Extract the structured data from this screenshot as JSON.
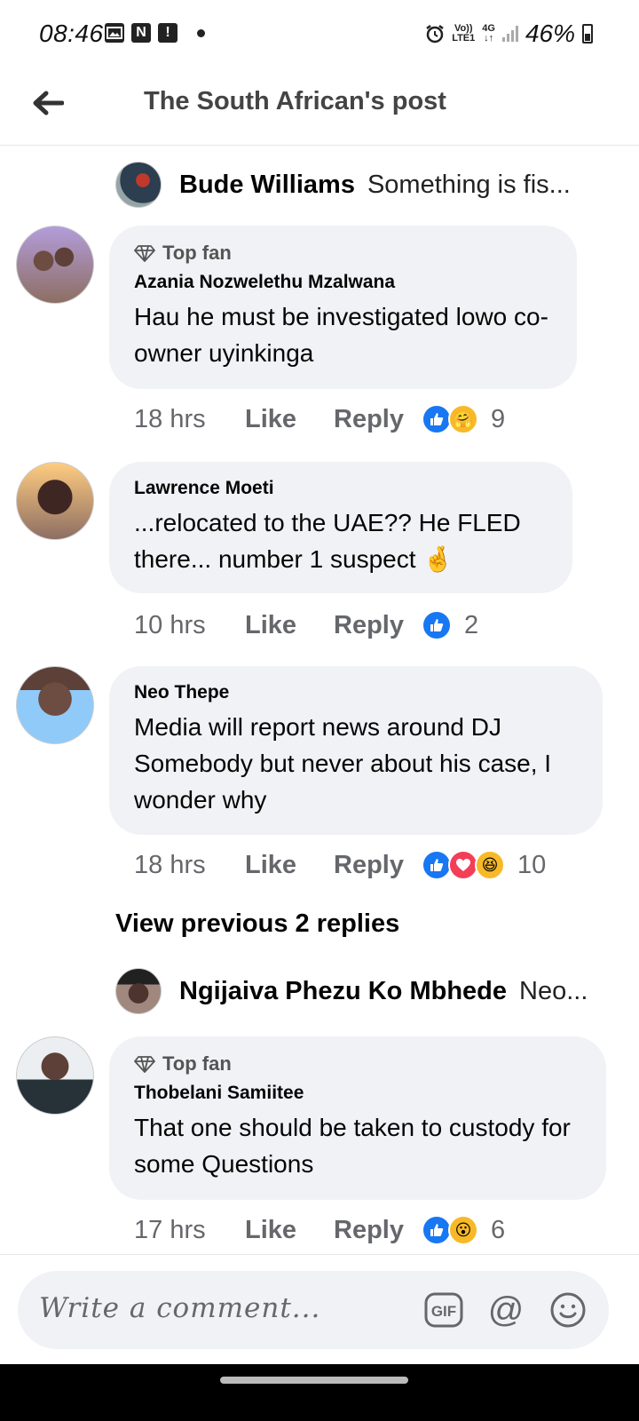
{
  "status_bar": {
    "time": "08:46",
    "volte": "Vo))",
    "lte": "LTE1",
    "network": "4G",
    "battery": "46%"
  },
  "header": {
    "title": "The South African's post"
  },
  "top_reply_preview": {
    "name": "Bude Williams",
    "text": "Something is fis..."
  },
  "comments": [
    {
      "badge": "Top fan",
      "name": "Azania Nozwelethu Mzalwana",
      "text": "Hau he must be investigated lowo co-owner uyinkinga",
      "time": "18 hrs",
      "like_label": "Like",
      "reply_label": "Reply",
      "reactions": [
        "like-icon",
        "care-icon"
      ],
      "reaction_count": "9"
    },
    {
      "name": "Lawrence Moeti",
      "text": "...relocated to the UAE?? He FLED there... number 1 suspect 🤞",
      "time": "10 hrs",
      "like_label": "Like",
      "reply_label": "Reply",
      "reactions": [
        "like-icon"
      ],
      "reaction_count": "2"
    },
    {
      "name": "Neo Thepe",
      "text": "Media will report news around DJ Somebody but never about his case, I wonder why",
      "time": "18 hrs",
      "like_label": "Like",
      "reply_label": "Reply",
      "reactions": [
        "like-icon",
        "love-icon",
        "haha-icon"
      ],
      "reaction_count": "10"
    },
    {
      "badge": "Top fan",
      "name": "Thobelani Samiitee",
      "text": "That one should be taken to custody for some Questions",
      "time": "17 hrs",
      "like_label": "Like",
      "reply_label": "Reply",
      "reactions": [
        "like-icon",
        "wow-icon"
      ],
      "reaction_count": "6"
    }
  ],
  "view_previous": "View previous 2 replies",
  "second_reply_preview": {
    "name": "Ngijaiva Phezu Ko Mbhede",
    "text": "Neo..."
  },
  "composer": {
    "placeholder": "Write a comment...",
    "gif_label": "GIF",
    "mention_label": "@"
  },
  "colors": {
    "bubble": "#f0f2f5",
    "like_blue": "#1877f2",
    "love_red": "#f33e58",
    "emoji_yellow": "#f7b928",
    "secondary_text": "#65676b"
  }
}
